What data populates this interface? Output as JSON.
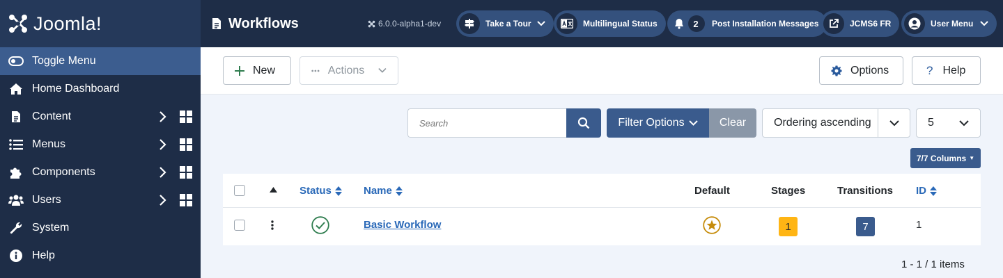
{
  "brand": {
    "name": "Joomla!"
  },
  "sidebar": {
    "items": [
      {
        "label": "Toggle Menu",
        "icon": "toggle-icon"
      },
      {
        "label": "Home Dashboard",
        "icon": "home-icon"
      },
      {
        "label": "Content",
        "icon": "file-icon",
        "has_submenu": true
      },
      {
        "label": "Menus",
        "icon": "list-icon",
        "has_submenu": true
      },
      {
        "label": "Components",
        "icon": "puzzle-icon",
        "has_submenu": true
      },
      {
        "label": "Users",
        "icon": "users-icon",
        "has_submenu": true
      },
      {
        "label": "System",
        "icon": "wrench-icon"
      },
      {
        "label": "Help",
        "icon": "info-icon"
      }
    ]
  },
  "header": {
    "title": "Workflows",
    "version": "6.0.0-alpha1-dev",
    "buttons": {
      "tour": "Take a Tour",
      "multilingual": "Multilingual Status",
      "post_install_count": "2",
      "post_install": "Post Installation Messages",
      "site": "JCMS6 FR",
      "user_menu": "User Menu"
    }
  },
  "toolbar": {
    "new_label": "New",
    "actions_label": "Actions",
    "options_label": "Options",
    "help_label": "Help"
  },
  "filters": {
    "search_placeholder": "Search",
    "filter_options_label": "Filter Options",
    "clear_label": "Clear",
    "ordering_value": "Ordering ascending",
    "limit_value": "5",
    "columns_label": "7/7 Columns"
  },
  "table": {
    "headers": {
      "status": "Status",
      "name": "Name",
      "default": "Default",
      "stages": "Stages",
      "transitions": "Transitions",
      "id": "ID"
    },
    "rows": [
      {
        "name": "Basic Workflow",
        "stages": "1",
        "transitions": "7",
        "id": "1",
        "is_default": true,
        "published": true
      }
    ]
  },
  "pagination": {
    "summary": "1 - 1 / 1 items"
  },
  "colors": {
    "sidebar_bg": "#1e2d47",
    "accent": "#3a5b8d",
    "link": "#2a69b8",
    "stage_badge": "#ffb514",
    "transition_badge": "#3a5b8d",
    "success": "#2f7d4f",
    "default_star": "#c68c0b"
  }
}
